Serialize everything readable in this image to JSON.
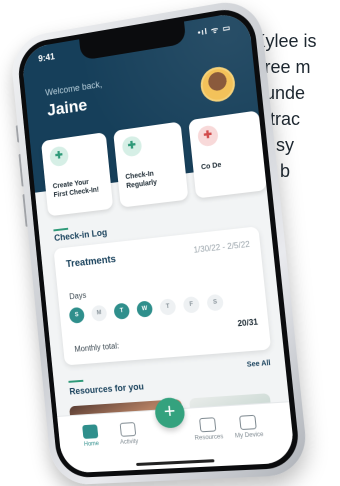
{
  "background_text": [
    "Kylee is",
    "free m",
    "unde",
    "trac",
    "sy",
    "b"
  ],
  "status_bar": {
    "time": "9:41",
    "icons": "•ıl ᯤ ▭"
  },
  "header": {
    "welcome": "Welcome back,",
    "user_name": "Jaine"
  },
  "cards": [
    {
      "label": "Create Your First Check-In!",
      "icon": "note-plus-icon"
    },
    {
      "label": "Check-In Regularly",
      "icon": "note-plus-icon"
    },
    {
      "label": "Co De",
      "icon": "note-plus-icon"
    }
  ],
  "checkin_log": {
    "title": "Check-in Log",
    "treatment_name": "Treatments",
    "date_range": "1/30/22 - 2/5/22",
    "days_label": "Days",
    "days": [
      {
        "letter": "S",
        "checked": true
      },
      {
        "letter": "M",
        "checked": false
      },
      {
        "letter": "T",
        "checked": true
      },
      {
        "letter": "W",
        "checked": true
      },
      {
        "letter": "T",
        "checked": false
      },
      {
        "letter": "F",
        "checked": false
      },
      {
        "letter": "S",
        "checked": false
      }
    ],
    "monthly_total_label": "Monthly total:",
    "monthly_total_value": "20/31"
  },
  "resources": {
    "title": "Resources for you",
    "see_all": "See All"
  },
  "tabbar": {
    "home": "Home",
    "activity": "Activity",
    "add": "+",
    "resources": "Resources",
    "my_device": "My Device"
  },
  "colors": {
    "header": "#163f5a",
    "accent": "#2f9a79",
    "day_on": "#2f8f8c"
  }
}
